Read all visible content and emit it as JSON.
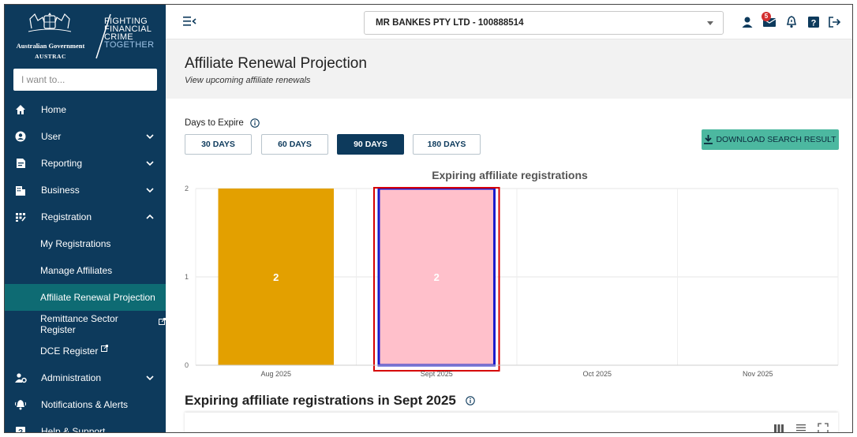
{
  "app": {
    "gov_name": "Australian Government",
    "agency": "AUSTRAC",
    "slogan": [
      "FIGHTING",
      "FINANCIAL",
      "CRIME",
      "TOGETHER"
    ]
  },
  "search": {
    "placeholder": "I want to..."
  },
  "sidebar": {
    "items": [
      {
        "label": "Home",
        "icon": "home-icon"
      },
      {
        "label": "User",
        "icon": "user-icon",
        "expand": "down"
      },
      {
        "label": "Reporting",
        "icon": "report-icon",
        "expand": "down"
      },
      {
        "label": "Business",
        "icon": "business-icon",
        "expand": "down"
      },
      {
        "label": "Registration",
        "icon": "registration-icon",
        "expand": "up"
      },
      {
        "label": "My Registrations",
        "sub": true
      },
      {
        "label": "Manage Affiliates",
        "sub": true
      },
      {
        "label": "Affiliate Renewal Projection",
        "sub": true,
        "active": true
      },
      {
        "label": "Remittance Sector Register",
        "sub": true,
        "external": true
      },
      {
        "label": "DCE Register",
        "sub": true,
        "external": true
      },
      {
        "label": "Administration",
        "icon": "admin-icon",
        "expand": "down"
      },
      {
        "label": "Notifications & Alerts",
        "icon": "bell-icon"
      },
      {
        "label": "Help & Support",
        "icon": "help-icon"
      }
    ]
  },
  "topbar": {
    "organisation": "MR BANKES PTY LTD - 100888514",
    "mail_count": "5"
  },
  "page": {
    "title": "Affiliate Renewal Projection",
    "subtitle": "View upcoming affiliate renewals"
  },
  "filter": {
    "label": "Days to Expire",
    "options": [
      "30 DAYS",
      "60 DAYS",
      "90 DAYS",
      "180 DAYS"
    ],
    "selected": "90 DAYS"
  },
  "download_label": "DOWNLOAD SEARCH RESULT",
  "section_title": "Expiring affiliate registrations in Sept 2025",
  "colors": {
    "sidebar": "#0d3a5c",
    "active": "#0e6b73",
    "bar": "#e3a000",
    "bar_selected": "#ffc0cb",
    "selected_outline": "#1a1acc",
    "highlight": "#d60000",
    "download_btn": "#4cb8a0"
  },
  "chart_data": {
    "type": "bar",
    "title": "Expiring affiliate registrations",
    "categories": [
      "Aug 2025",
      "Sept 2025",
      "Oct 2025",
      "Nov 2025"
    ],
    "values": [
      2,
      2,
      0,
      0
    ],
    "selected_category": "Sept 2025",
    "ylim": [
      0,
      2
    ],
    "yticks": [
      0,
      1,
      2
    ],
    "grid": true,
    "data_labels": true
  }
}
